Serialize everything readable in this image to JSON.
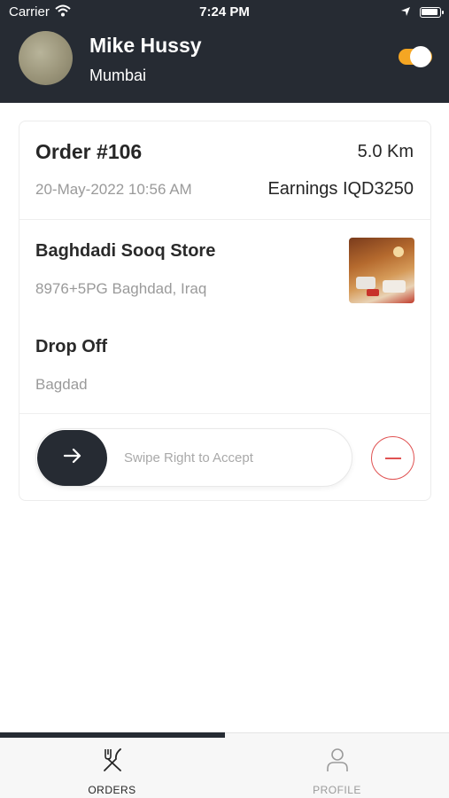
{
  "status_bar": {
    "carrier": "Carrier",
    "time": "7:24 PM",
    "wifi_icon": "wifi-icon",
    "location_icon": "location-arrow-icon",
    "battery_icon": "battery-icon"
  },
  "header": {
    "user_name": "Mike Hussy",
    "city": "Mumbai",
    "online_toggle_on": true,
    "background_color": "#262b33",
    "toggle_color": "#f5a623"
  },
  "order": {
    "number": "Order #106",
    "distance": "5.0 Km",
    "date": "20-May-2022 10:56 AM",
    "earnings": "Earnings IQD3250",
    "store": {
      "name": "Baghdadi Sooq Store",
      "address": "8976+5PG Baghdad, Iraq"
    },
    "dropoff": {
      "label": "Drop Off",
      "address": "Bagdad"
    },
    "swipe_label": "Swipe Right to Accept",
    "accept_icon": "arrow-right-icon",
    "reject_icon": "minus-circle-icon",
    "reject_color": "#e05252"
  },
  "tabs": [
    {
      "label": "ORDERS",
      "icon": "fork-knife-icon",
      "active": true
    },
    {
      "label": "PROFILE",
      "icon": "person-icon",
      "active": false
    }
  ]
}
